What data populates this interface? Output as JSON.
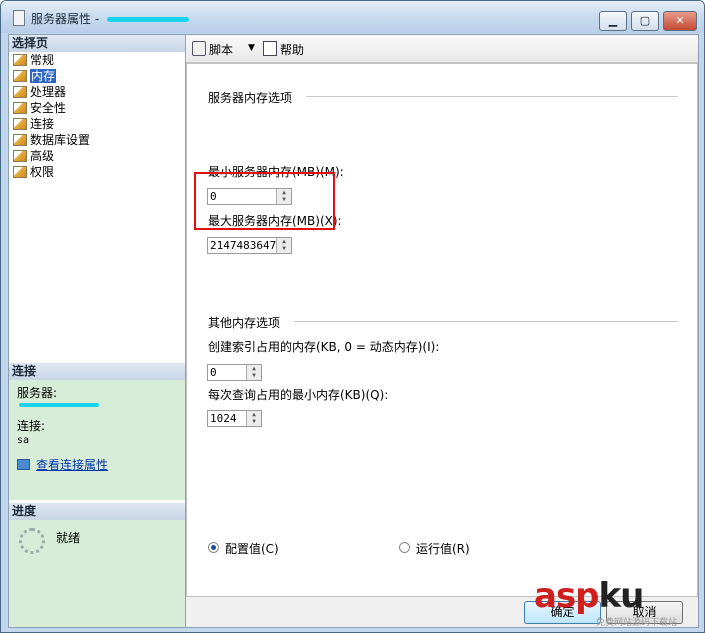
{
  "window": {
    "title": "服务器属性 - "
  },
  "left_panel": {
    "select_page_header": "选择页",
    "pages": [
      {
        "label": "常规",
        "selected": false
      },
      {
        "label": "内存",
        "selected": true
      },
      {
        "label": "处理器",
        "selected": false
      },
      {
        "label": "安全性",
        "selected": false
      },
      {
        "label": "连接",
        "selected": false
      },
      {
        "label": "数据库设置",
        "selected": false
      },
      {
        "label": "高级",
        "selected": false
      },
      {
        "label": "权限",
        "selected": false
      }
    ],
    "connection_header": "连接",
    "server_label": "服务器:",
    "connection_label": "连接:",
    "connection_value": "sa",
    "view_connection_link": "查看连接属性",
    "progress_header": "进度",
    "progress_status": "就绪"
  },
  "toolbar": {
    "script_label": "脚本",
    "help_label": "帮助"
  },
  "memory": {
    "group_title": "服务器内存选项",
    "min_label": "最小服务器内存(MB)(M):",
    "min_value": "0",
    "max_label": "最大服务器内存(MB)(X):",
    "max_value": "2147483647"
  },
  "other": {
    "group_title": "其他内存选项",
    "index_label": "创建索引占用的内存(KB, 0 = 动态内存)(I):",
    "index_value": "0",
    "query_label": "每次查询占用的最小内存(KB)(Q):",
    "query_value": "1024"
  },
  "radios": {
    "configured_label": "配置值(C)",
    "running_label": "运行值(R)",
    "selected": "configured"
  },
  "buttons": {
    "ok_label": "确定",
    "cancel_label": "取消"
  },
  "watermark": {
    "text_asp": "asp",
    "text_ku": "ku",
    "sub": "免费网站源码下载站",
    "colors": {
      "asp": "#d01f1f",
      "ku": "#222222"
    }
  }
}
